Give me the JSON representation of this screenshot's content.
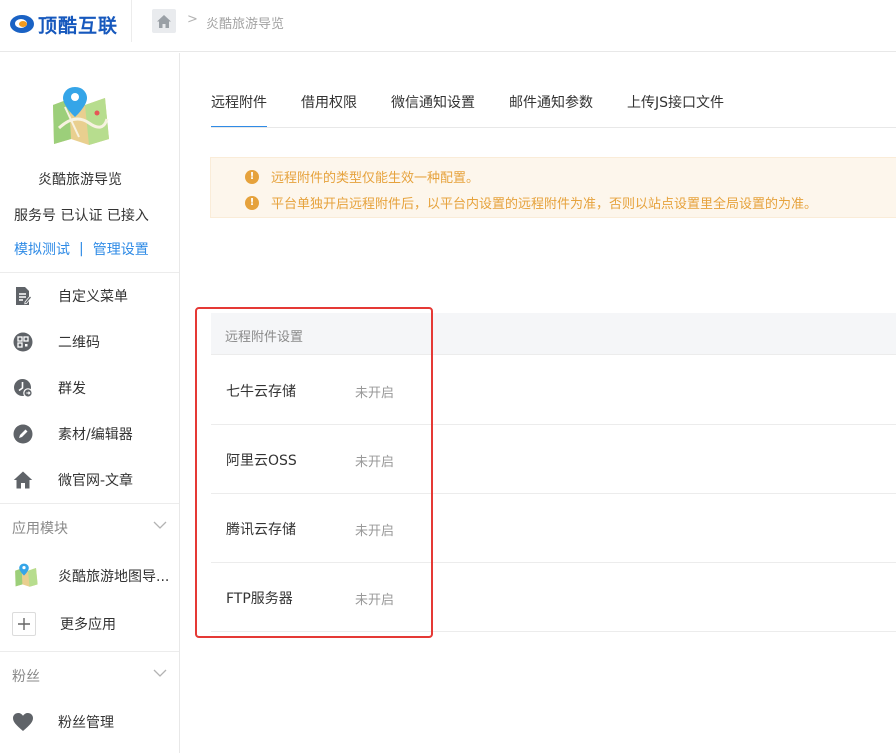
{
  "header": {
    "logo_text": "顶酷互联",
    "breadcrumb_sep": ">",
    "breadcrumb_current": "炎酷旅游导览"
  },
  "account": {
    "name": "炎酷旅游导览",
    "status": "服务号 已认证 已接入",
    "link_test": "模拟测试",
    "link_sep": "|",
    "link_manage": "管理设置"
  },
  "sidebar": {
    "items": [
      {
        "label": "自定义菜单",
        "icon": "document-edit-icon"
      },
      {
        "label": "二维码",
        "icon": "qrcode-icon"
      },
      {
        "label": "群发",
        "icon": "clock-send-icon"
      },
      {
        "label": "素材/编辑器",
        "icon": "pencil-icon"
      },
      {
        "label": "微官网-文章",
        "icon": "home-icon"
      }
    ],
    "group_apps": {
      "title": "应用模块"
    },
    "app_items": [
      {
        "label": "炎酷旅游地图导...",
        "icon": "map-app-icon"
      },
      {
        "label": "更多应用",
        "icon": "plus-icon"
      }
    ],
    "group_fans": {
      "title": "粉丝"
    },
    "fan_items": [
      {
        "label": "粉丝管理",
        "icon": "heart-icon"
      }
    ]
  },
  "tabs": [
    {
      "label": "远程附件",
      "active": true
    },
    {
      "label": "借用权限",
      "active": false
    },
    {
      "label": "微信通知设置",
      "active": false
    },
    {
      "label": "邮件通知参数",
      "active": false
    },
    {
      "label": "上传JS接口文件",
      "active": false
    }
  ],
  "notice": {
    "color": "#e6a23c",
    "line1": "远程附件的类型仅能生效一种配置。",
    "line2": "平台单独开启远程附件后，以平台内设置的远程附件为准，否则以站点设置里全局设置的为准。"
  },
  "remote": {
    "header": "远程附件设置",
    "rows": [
      {
        "name": "七牛云存储",
        "state": "未开启"
      },
      {
        "name": "阿里云OSS",
        "state": "未开启"
      },
      {
        "name": "腾讯云存储",
        "state": "未开启"
      },
      {
        "name": "FTP服务器",
        "state": "未开启"
      }
    ]
  },
  "colors": {
    "accent": "#2f8be6",
    "highlight_box": "#e53935"
  }
}
